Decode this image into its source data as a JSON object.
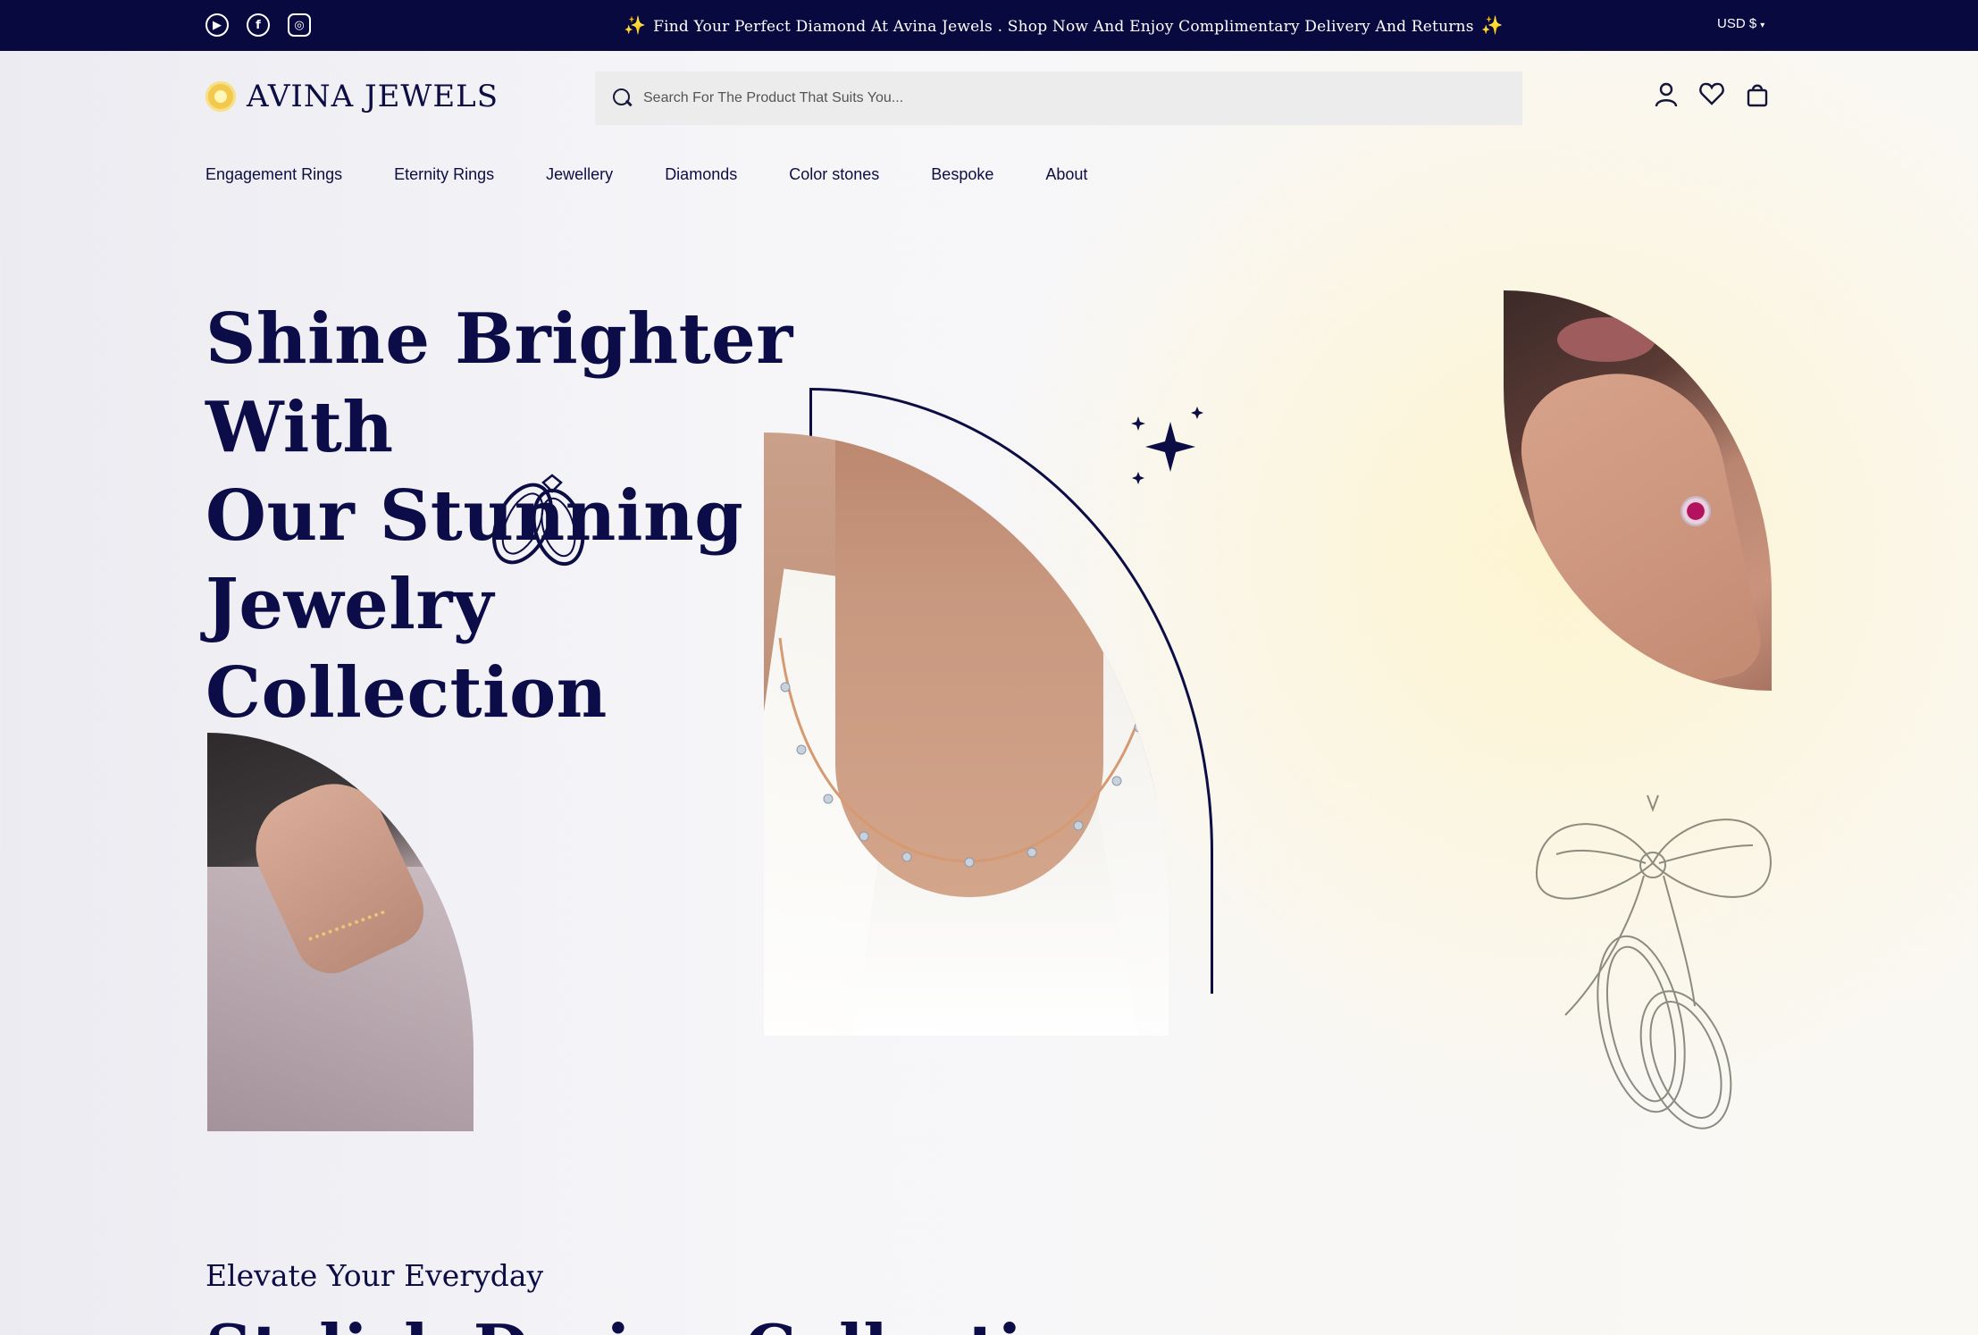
{
  "topbar": {
    "socials": [
      {
        "name": "youtube-icon",
        "glyph": "▶"
      },
      {
        "name": "facebook-icon",
        "glyph": "f"
      },
      {
        "name": "instagram-icon",
        "glyph": "◎"
      }
    ],
    "announcement": "Find Your Perfect Diamond At Avina Jewels . Shop Now And Enjoy Complimentary Delivery And Returns",
    "currency": "USD $"
  },
  "header": {
    "logo_text": "AVINA JEWELS",
    "search_placeholder": "Search For The Product That Suits You..."
  },
  "nav": {
    "items": [
      "Engagement Rings",
      "Eternity Rings",
      "Jewellery",
      "Diamonds",
      "Color stones",
      "Bespoke",
      "About"
    ]
  },
  "hero": {
    "title_line1": "Shine Brighter With",
    "title_line2": "Our Stunning",
    "title_line3": "Jewelry",
    "title_line4": "Collection"
  },
  "section": {
    "kicker": "Elevate Your Everyday",
    "title": "Stylish Design Collection"
  },
  "colors": {
    "brand_navy": "#08093f",
    "accent_gold": "#f2c94c",
    "heading": "#0c0c48"
  }
}
